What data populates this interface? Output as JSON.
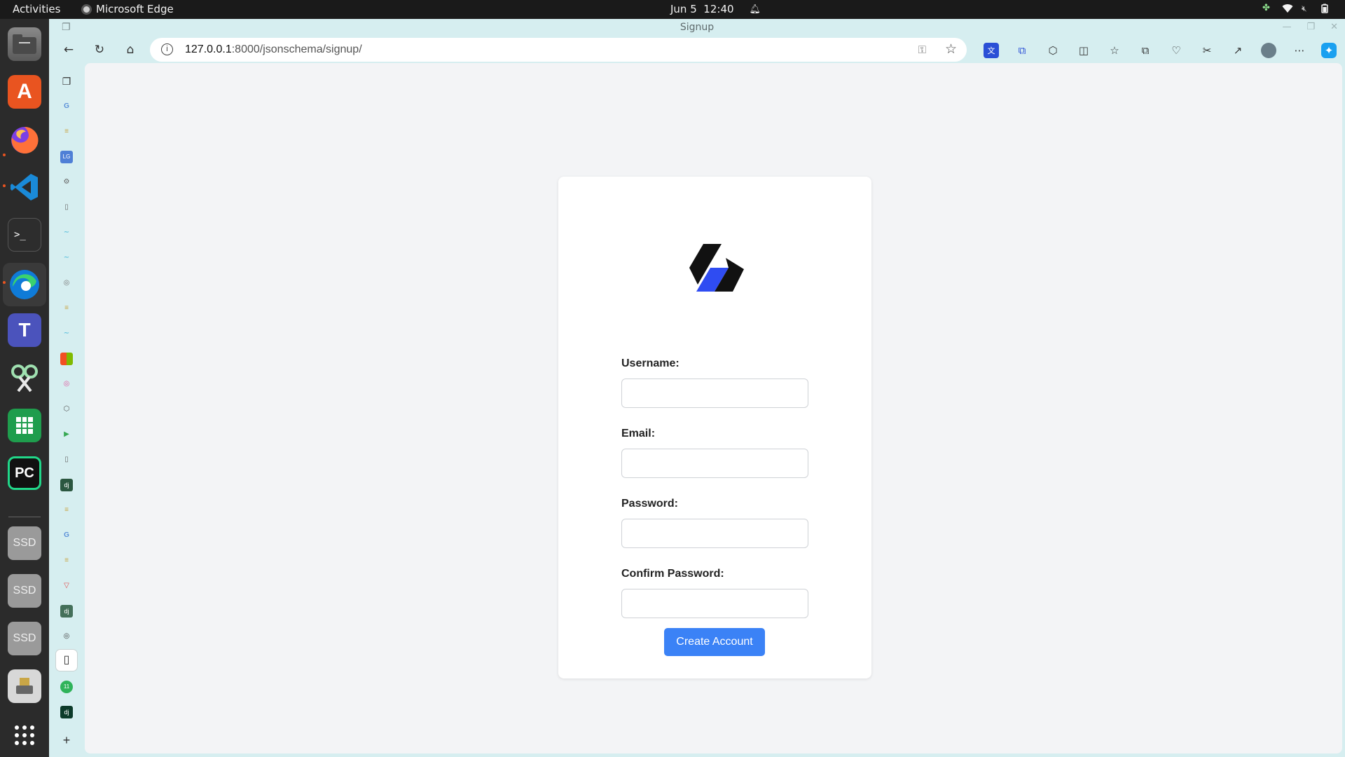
{
  "system": {
    "activities_label": "Activities",
    "app_name": "Microsoft Edge",
    "date": "Jun 5",
    "time": "12:40"
  },
  "dock": {
    "items": [
      {
        "name": "files",
        "label": ""
      },
      {
        "name": "app-center",
        "label": "A"
      },
      {
        "name": "firefox",
        "label": ""
      },
      {
        "name": "vscode",
        "label": ""
      },
      {
        "name": "terminal",
        "label": ">_"
      },
      {
        "name": "edge",
        "label": ""
      },
      {
        "name": "teams",
        "label": "T"
      },
      {
        "name": "screenshot-tool",
        "label": ""
      },
      {
        "name": "spreadsheet",
        "label": ""
      },
      {
        "name": "pycharm",
        "label": "PC"
      }
    ],
    "drives": [
      "SSD",
      "SSD",
      "SSD"
    ]
  },
  "browser": {
    "window_title": "Signup",
    "address": {
      "host": "127.0.0.1",
      "path": ":8000/jsonschema/signup/"
    }
  },
  "signup": {
    "username_label": "Username:",
    "email_label": "Email:",
    "password_label": "Password:",
    "confirm_label": "Confirm Password:",
    "username_value": "",
    "email_value": "",
    "password_value": "",
    "confirm_value": "",
    "submit_label": "Create Account"
  },
  "colors": {
    "accent": "#3b82f6",
    "logo_dark": "#111111",
    "logo_blue": "#2f4cf2",
    "page_bg": "#f3f4f6"
  }
}
